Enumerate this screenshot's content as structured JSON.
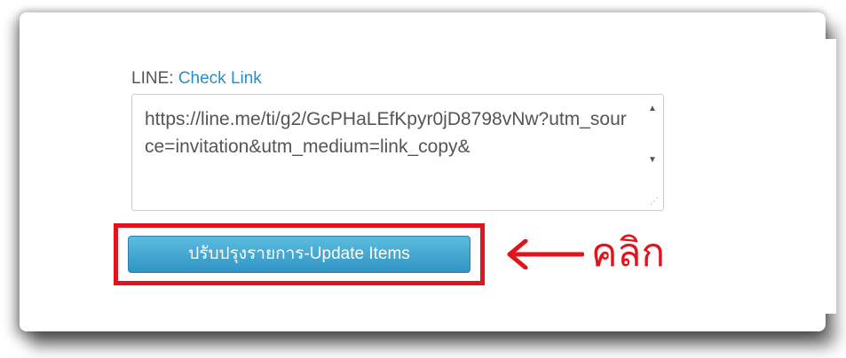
{
  "form": {
    "line_label_prefix": "LINE:",
    "check_link_label": "Check Link",
    "url_value": "https://line.me/ti/g2/GcPHaLEfKpyr0jD8798vNw?utm_source=invitation&utm_medium=link_copy&",
    "update_button_label": "ปรับปรุงรายการ-Update Items"
  },
  "annotation": {
    "click_text": "คลิก",
    "highlight_color": "#e1141c"
  },
  "colors": {
    "link": "#2a8fc4",
    "button_top": "#5bbde0",
    "button_bottom": "#3194c4"
  }
}
